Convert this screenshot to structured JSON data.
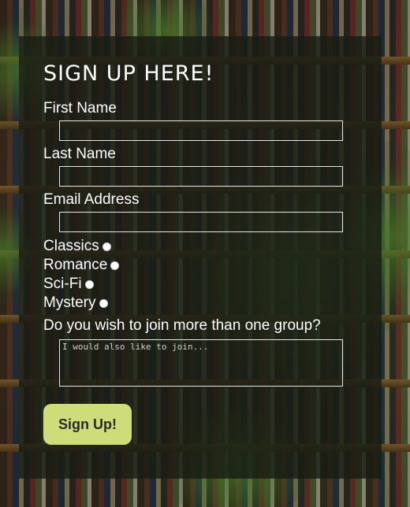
{
  "form": {
    "title": "SIGN UP HERE!",
    "first_name_label": "First Name",
    "first_name_value": "",
    "last_name_label": "Last Name",
    "last_name_value": "",
    "email_label": "Email Address",
    "email_value": "",
    "genres": [
      {
        "label": "Classics",
        "selected": false
      },
      {
        "label": "Romance",
        "selected": false
      },
      {
        "label": "Sci-Fi",
        "selected": false
      },
      {
        "label": "Mystery",
        "selected": false
      }
    ],
    "question_label": "Do you wish to join more than one group?",
    "textarea_placeholder": "I would also like to join...",
    "textarea_value": "",
    "submit_label": "Sign Up!"
  },
  "colors": {
    "panel_background": "#181c14",
    "text": "#ffffff",
    "button_background": "#cfdc7a",
    "button_text": "#2a2a2a",
    "input_border": "#e8e8e8"
  }
}
